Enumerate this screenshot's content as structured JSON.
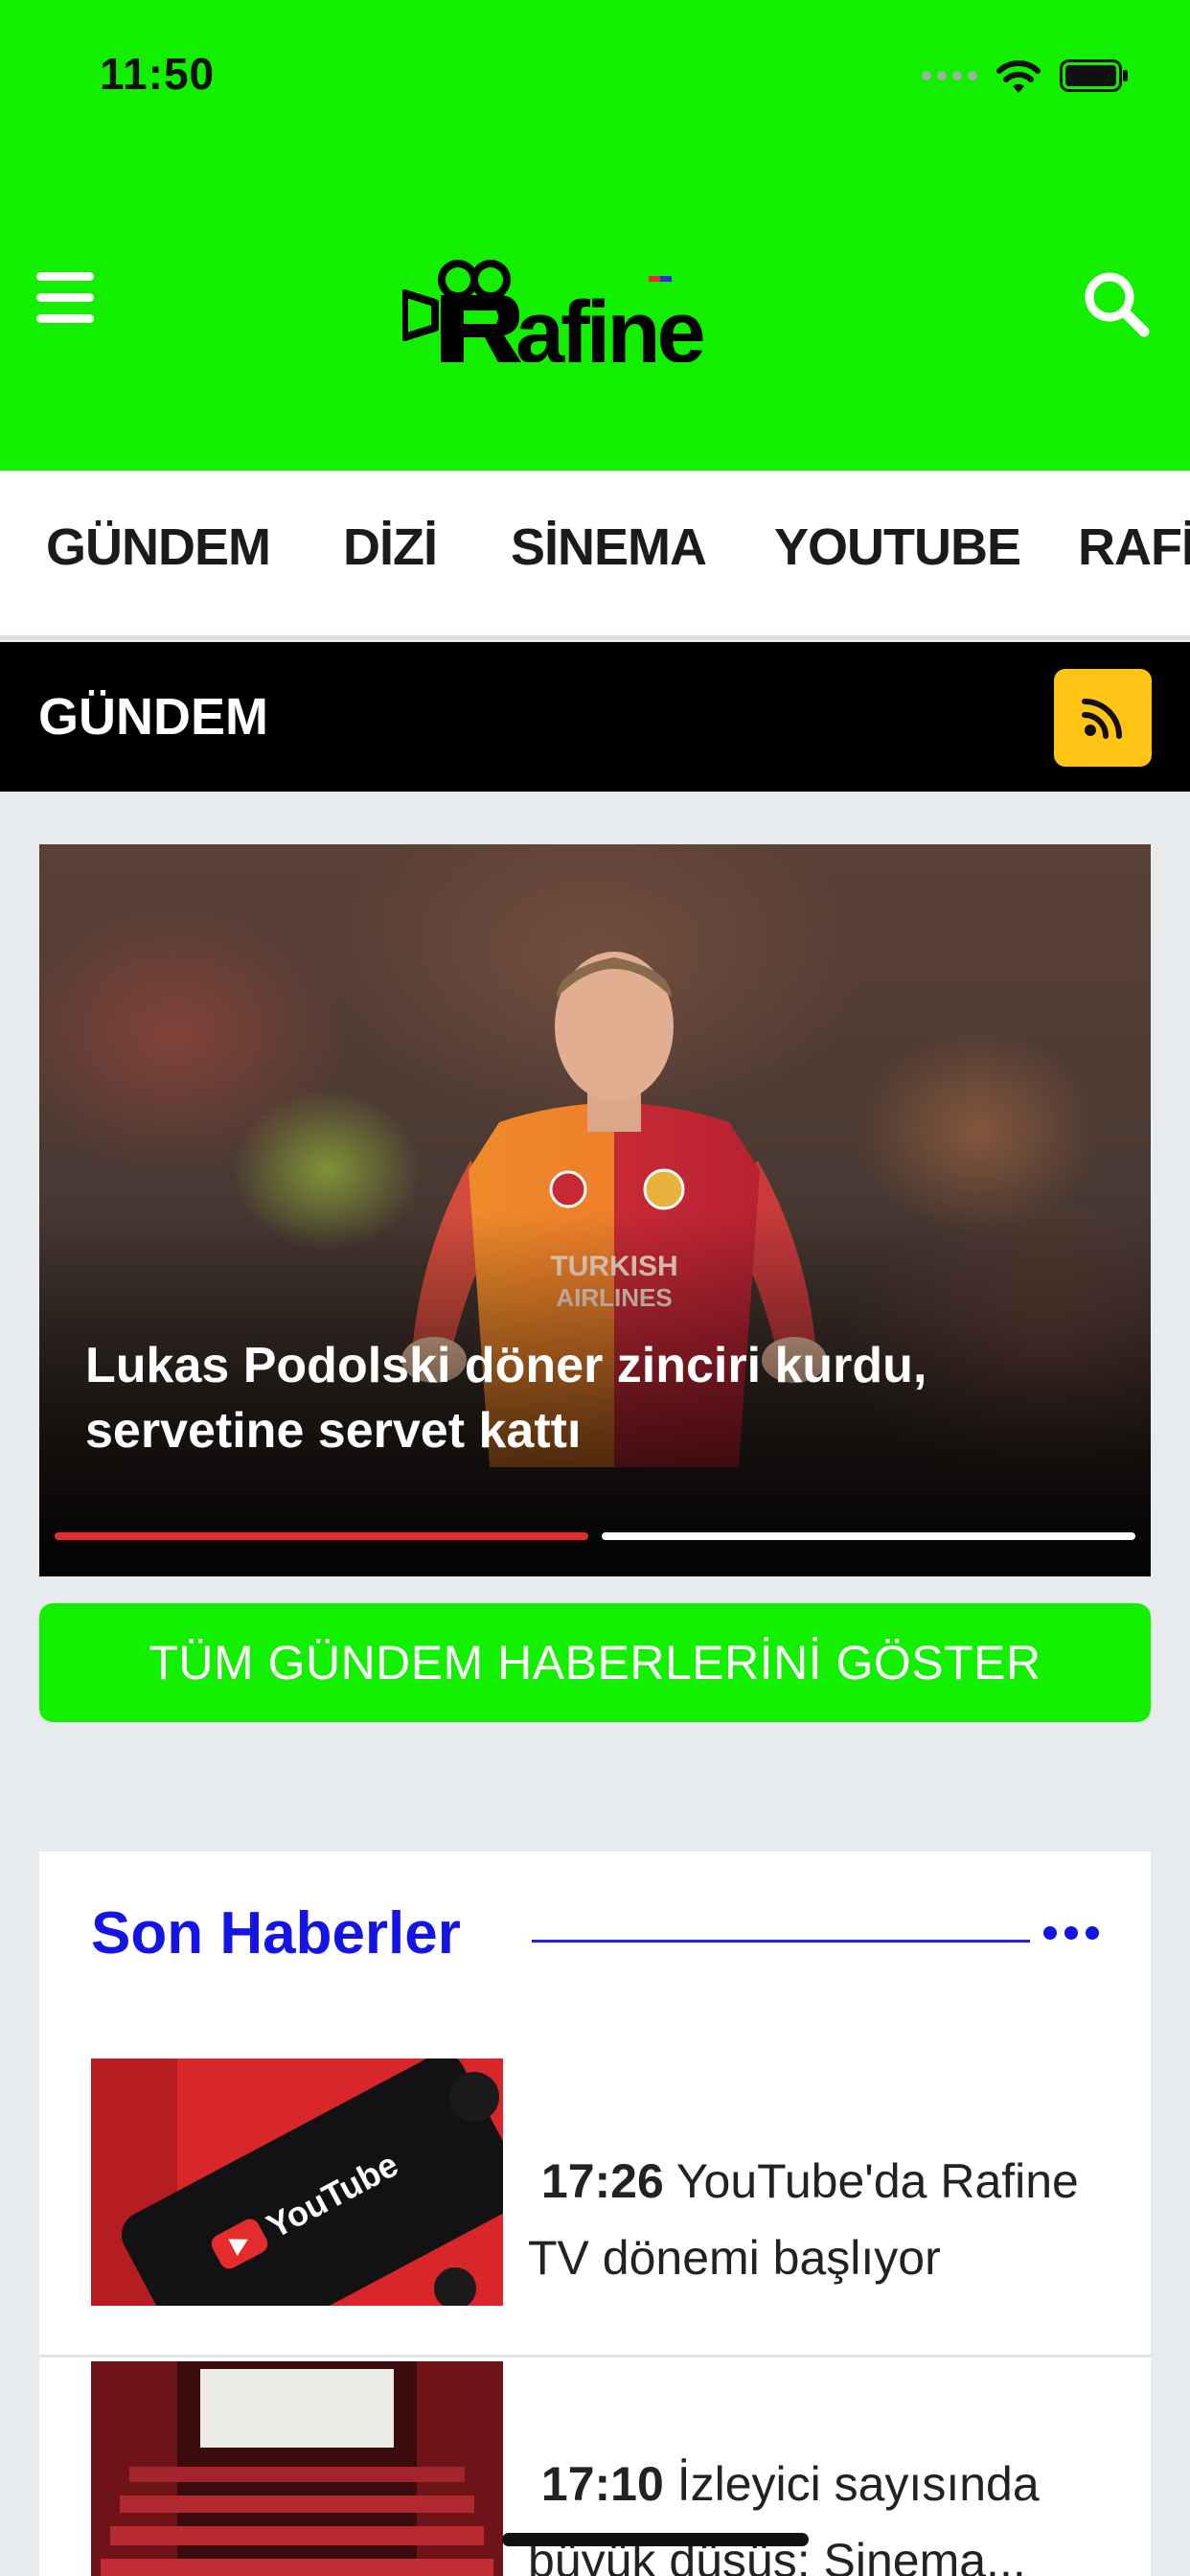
{
  "status": {
    "time": "11:50"
  },
  "header": {
    "logo_text": "Rafine"
  },
  "categories": [
    "GÜNDEM",
    "DİZİ",
    "SİNEMA",
    "YOUTUBE",
    "RAFİ"
  ],
  "section": {
    "title": "GÜNDEM"
  },
  "hero": {
    "caption_line1": "Lukas Podolski döner zinciri kurdu,",
    "caption_line2": "servetine servet kattı",
    "slides": 2,
    "active_slide": 1
  },
  "all_button": {
    "label": "TÜM GÜNDEM HABERLERİNİ GÖSTER"
  },
  "latest": {
    "title": "Son Haberler",
    "items": [
      {
        "time": "17:26",
        "title": "YouTube'da Rafine TV dönemi başlıyor",
        "thumb": "youtube-phone-image"
      },
      {
        "time": "17:10",
        "title": "İzleyici sayısında büyük düşüş: Sinema...",
        "thumb": "cinema-hall-image"
      }
    ]
  },
  "colors": {
    "brand_green": "#12f000",
    "accent_blue": "#1414e6",
    "rss_yellow": "#ffc414",
    "progress_red": "#e52b2b"
  }
}
